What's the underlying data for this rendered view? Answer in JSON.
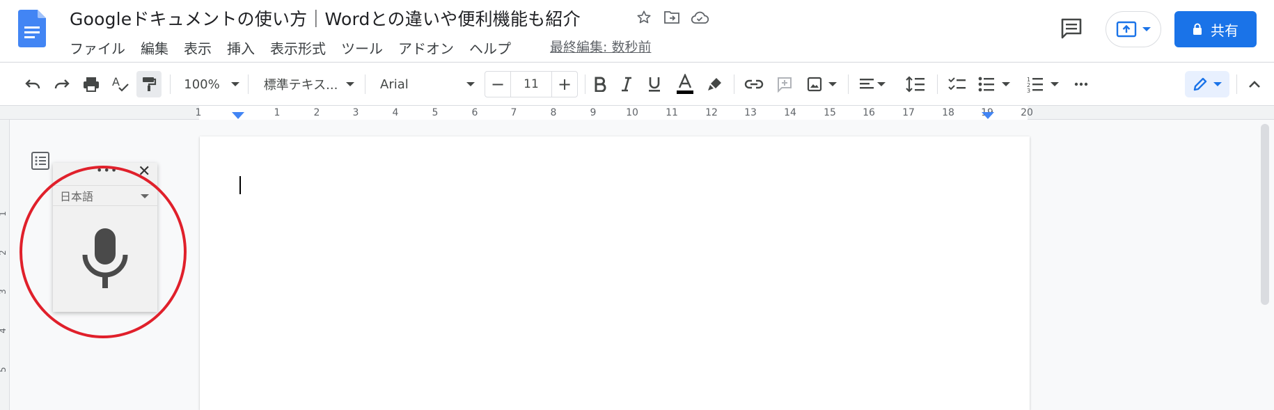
{
  "document": {
    "title": "Googleドキュメントの使い方｜Wordとの違いや便利機能も紹介",
    "last_edit": "最終編集: 数秒前"
  },
  "menu": {
    "items": [
      "ファイル",
      "編集",
      "表示",
      "挿入",
      "表示形式",
      "ツール",
      "アドオン",
      "ヘルプ"
    ]
  },
  "header": {
    "share_label": "共有"
  },
  "toolbar": {
    "zoom": "100%",
    "style": "標準テキス...",
    "font": "Arial",
    "font_size": "11",
    "minus": "−",
    "plus": "+"
  },
  "ruler": {
    "labels": [
      "1",
      "1",
      "2",
      "3",
      "4",
      "5",
      "6",
      "7",
      "8",
      "9",
      "10",
      "11",
      "12",
      "13",
      "14",
      "15",
      "16",
      "17",
      "18",
      "19",
      "20"
    ],
    "vertical_labels": [
      "1",
      "2",
      "3",
      "4",
      "5"
    ]
  },
  "voice_panel": {
    "dots": "•••",
    "close": "✕",
    "language": "日本語"
  },
  "colors": {
    "accent": "#1a73e8",
    "highlight_circle": "#e0202b"
  }
}
